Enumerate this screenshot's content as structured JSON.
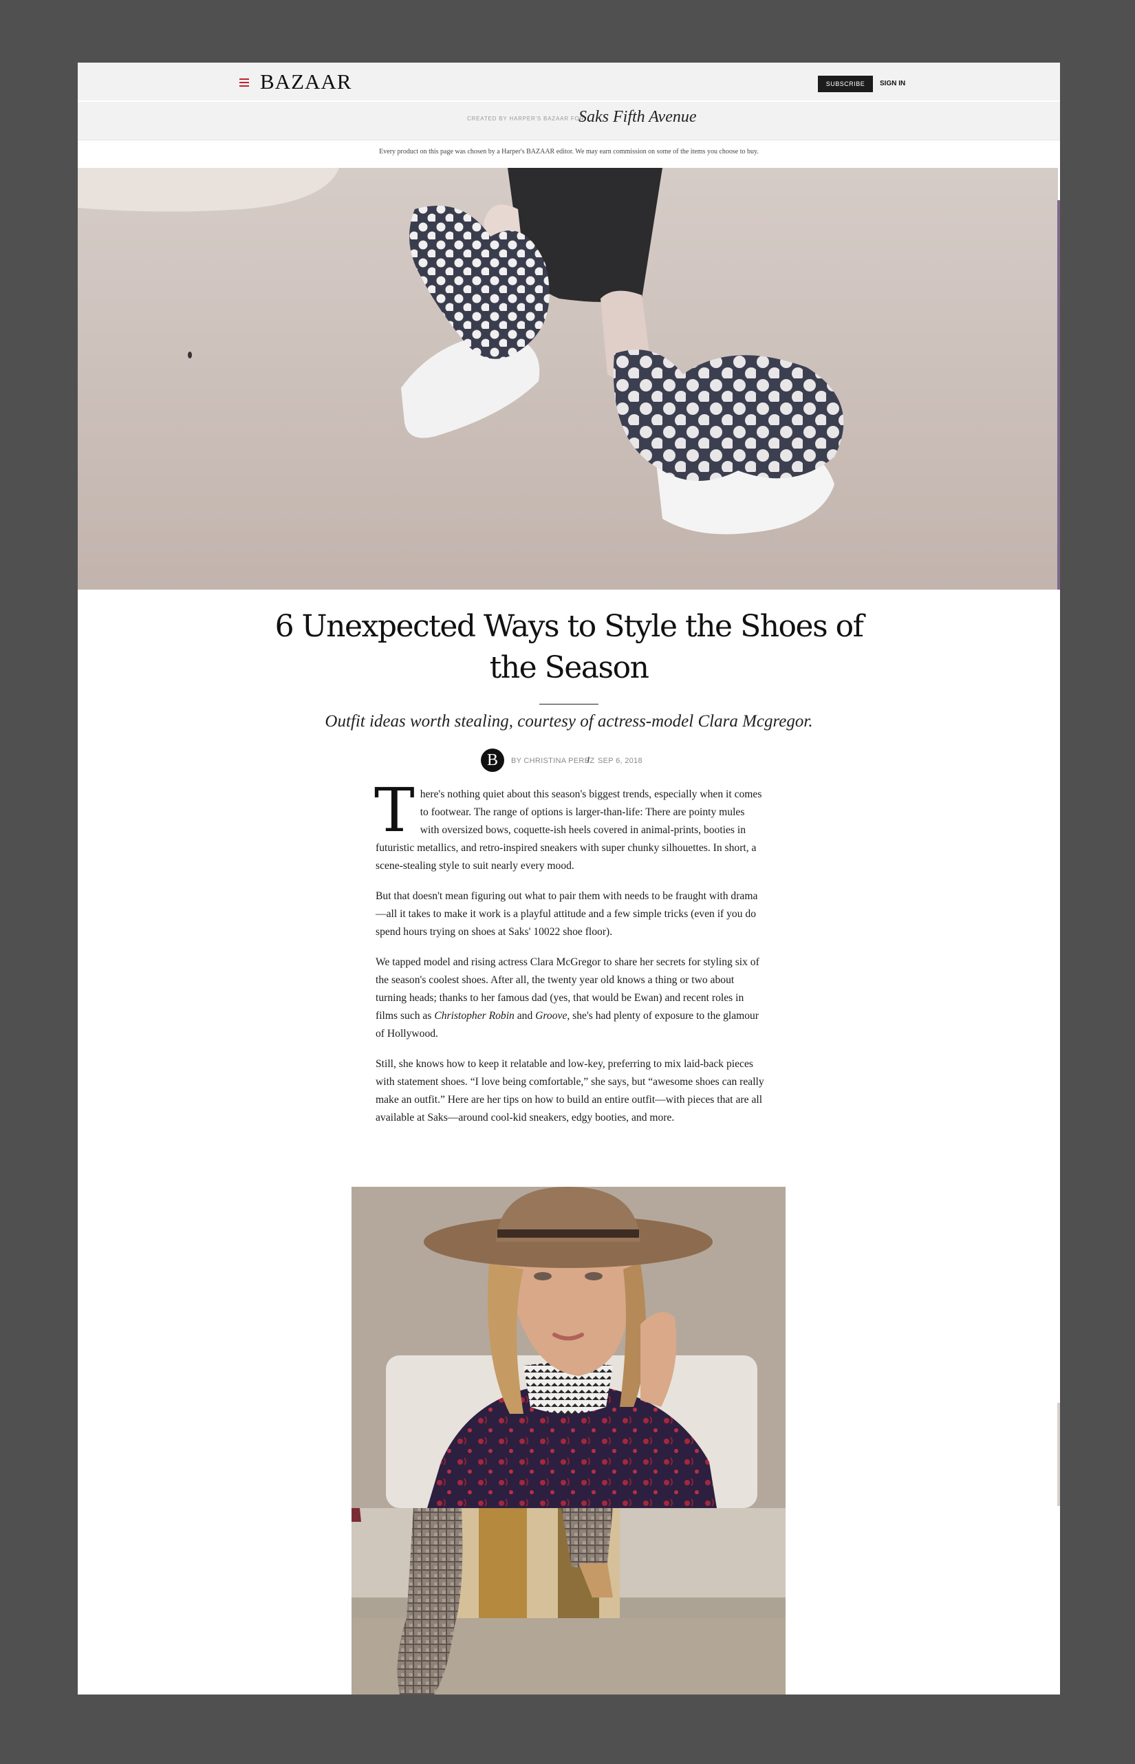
{
  "header": {
    "logo": "BAZAAR",
    "subscribe_label": "SUBSCRIBE",
    "signin_label": "SIGN IN",
    "partner_label": "CREATED BY HARPER'S BAZAAR FOR",
    "partner_name": "Saks Fifth Avenue"
  },
  "disclaimer": "Every product on this page was chosen by a Harper's BAZAAR editor. We may earn commission on some of the items you choose to buy.",
  "article": {
    "title": "6 Unexpected Ways to Style the Shoes of the Season",
    "dek": "Outfit ideas worth stealing, courtesy of actress-model Clara Mcgregor.",
    "avatar_letter": "B",
    "author": "BY CHRISTINA PEREZ",
    "date": "SEP 6, 2018",
    "p1_dropcap": "T",
    "p1": "here's nothing quiet about this season's biggest trends, especially when it comes to footwear. The range of options is larger-than-life: There are pointy mules with oversized bows, coquette-ish heels covered in animal-prints, booties in futuristic metallics, and retro-inspired sneakers with super chunky silhouettes. In short, a scene-stealing style to suit nearly every mood.",
    "p2": "But that doesn't mean figuring out what to pair them with needs to be fraught with drama—all it takes to make it work is a playful attitude and a few simple tricks (even if you do spend hours trying on shoes at Saks' 10022 shoe floor).",
    "p3_a": "We tapped model and rising actress Clara McGregor to share her secrets for styling six of the season's coolest shoes. After all, the twenty year old knows a thing or two about turning heads; thanks to her famous dad (yes, that would be Ewan) and recent roles in films such as ",
    "p3_film1": "Christopher Robin",
    "p3_and": " and ",
    "p3_film2": "Groove",
    "p3_b": ", she's had plenty of exposure to the glamour of Hollywood.",
    "p4": "Still, she knows how to keep it relatable and low-key, preferring to mix laid-back pieces with statement shoes. “I love being comfortable,” she says, but “awesome shoes can really make an outfit.” Here are her tips on how to build an entire outfit—with pieces that are all available at Saks—around cool-kid sneakers, edgy booties, and more."
  },
  "colors": {
    "background": "#505050",
    "header_bg": "#f2f2f2",
    "menu_accent": "#c0232d",
    "button_bg": "#1c1c1c"
  }
}
